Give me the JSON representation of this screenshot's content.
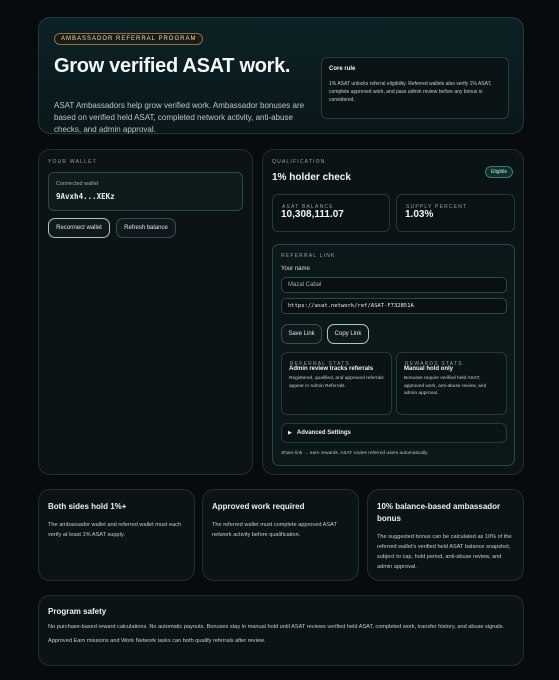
{
  "hero": {
    "pill": "AMBASSADOR REFERRAL PROGRAM",
    "title": "Grow verified ASAT work.",
    "description": "ASAT Ambassadors help grow verified work. Ambassador bonuses are based on verified held ASAT, completed network activity, anti-abuse checks, and admin approval.",
    "core_rule_title": "Core rule",
    "core_rule_body": "1% ASAT unlocks referral eligibility. Referred wallets also verify 1% ASAT, complete approved work, and pass admin review before any bonus is considered."
  },
  "wallet": {
    "section_label": "YOUR WALLET",
    "connected_label": "Connected wallet",
    "address": "9Avxh4...XEKz",
    "reconnect_label": "Reconnect wallet",
    "refresh_label": "Refresh balance"
  },
  "qualification": {
    "section_label": "QUALIFICATION",
    "title": "1% holder check",
    "badge": "Eligible",
    "balance_label": "ASAT BALANCE",
    "balance_value": "10,308,111.07",
    "supply_label": "SUPPLY PERCENT",
    "supply_value": "1.03%"
  },
  "referral": {
    "section_label": "REFERRAL LINK",
    "name_label": "Your name",
    "name_value": "Mazal Cabal",
    "link_value": "https://asat.network/ref/ASAT-F732B51A",
    "save_label": "Save Link",
    "copy_label": "Copy Link",
    "stats_label": "REFERRAL STATS",
    "stats_title": "Admin review tracks referrals",
    "stats_body": "Registered, qualified, and approved referrals appear in Admin Referrals.",
    "rewards_label": "REWARDS STATS",
    "rewards_title": "Manual hold only",
    "rewards_body": "Bonuses require verified held ASAT, approved work, anti-abuse review, and admin approval.",
    "advanced_label": "Advanced Settings",
    "footer_note": "Share link → earn rewards. ASAT routes referred users automatically."
  },
  "info_cards": [
    {
      "title": "Both sides hold 1%+",
      "body": "The ambassador wallet and referred wallet must each verify at least 1% ASAT supply."
    },
    {
      "title": "Approved work required",
      "body": "The referred wallet must complete approved ASAT network activity before qualification."
    },
    {
      "title": "10% balance-based ambassador bonus",
      "body": "The suggested bonus can be calculated as 10% of the referred wallet's verified held ASAT balance snapshot, subject to cap, hold period, anti-abuse review, and admin approval."
    }
  ],
  "safety": {
    "title": "Program safety",
    "body": "No purchase-based reward calculations. No automatic payouts. Bonuses stay in manual hold until ASAT reviews verified held ASAT, completed work, transfer history, and abuse signals.",
    "body2": "Approved Earn missions and Work Network tasks can both qualify referrals after review."
  }
}
